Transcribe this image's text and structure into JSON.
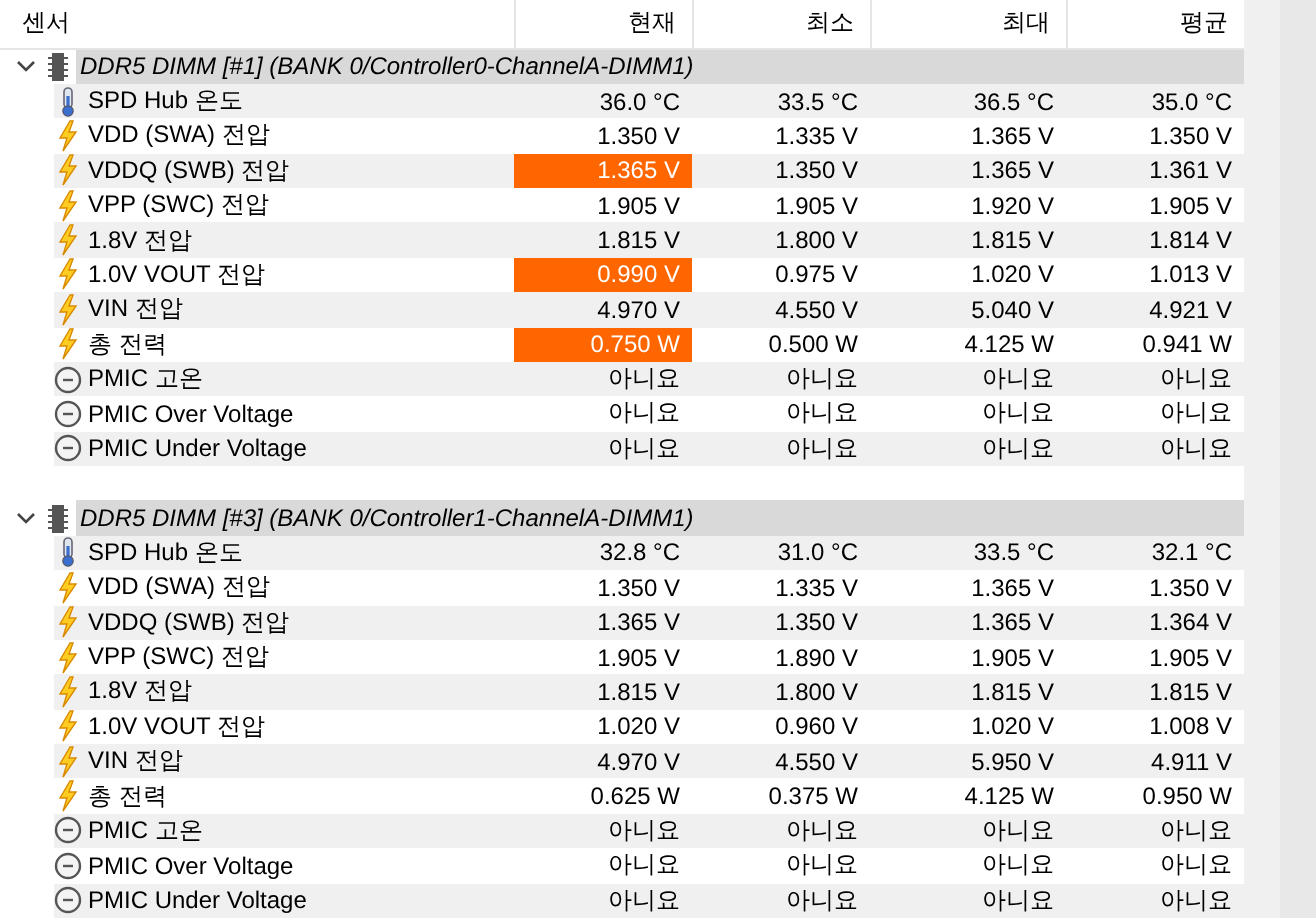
{
  "columns": [
    "센서",
    "현재",
    "최소",
    "최대",
    "평균"
  ],
  "groups": [
    {
      "title": "DDR5 DIMM [#1] (BANK 0/Controller0-ChannelA-DIMM1)",
      "expanded": true,
      "rows": [
        {
          "kind": "temp",
          "label": "SPD Hub 온도",
          "alert": false,
          "values": [
            "36.0 °C",
            "33.5 °C",
            "36.5 °C",
            "35.0 °C"
          ]
        },
        {
          "kind": "volt",
          "label": "VDD (SWA) 전압",
          "alert": false,
          "values": [
            "1.350 V",
            "1.335 V",
            "1.365 V",
            "1.350 V"
          ]
        },
        {
          "kind": "volt",
          "label": "VDDQ (SWB) 전압",
          "alert": true,
          "values": [
            "1.365 V",
            "1.350 V",
            "1.365 V",
            "1.361 V"
          ]
        },
        {
          "kind": "volt",
          "label": "VPP (SWC) 전압",
          "alert": false,
          "values": [
            "1.905 V",
            "1.905 V",
            "1.920 V",
            "1.905 V"
          ]
        },
        {
          "kind": "volt",
          "label": "1.8V 전압",
          "alert": false,
          "values": [
            "1.815 V",
            "1.800 V",
            "1.815 V",
            "1.814 V"
          ]
        },
        {
          "kind": "volt",
          "label": "1.0V VOUT 전압",
          "alert": true,
          "values": [
            "0.990 V",
            "0.975 V",
            "1.020 V",
            "1.013 V"
          ]
        },
        {
          "kind": "volt",
          "label": "VIN 전압",
          "alert": false,
          "values": [
            "4.970 V",
            "4.550 V",
            "5.040 V",
            "4.921 V"
          ]
        },
        {
          "kind": "volt",
          "label": "총 전력",
          "alert": true,
          "values": [
            "0.750 W",
            "0.500 W",
            "4.125 W",
            "0.941 W"
          ]
        },
        {
          "kind": "flag",
          "label": "PMIC 고온",
          "alert": false,
          "values": [
            "아니요",
            "아니요",
            "아니요",
            "아니요"
          ]
        },
        {
          "kind": "flag",
          "label": "PMIC Over Voltage",
          "alert": false,
          "values": [
            "아니요",
            "아니요",
            "아니요",
            "아니요"
          ]
        },
        {
          "kind": "flag",
          "label": "PMIC Under Voltage",
          "alert": false,
          "values": [
            "아니요",
            "아니요",
            "아니요",
            "아니요"
          ]
        }
      ]
    },
    {
      "title": "DDR5 DIMM [#3] (BANK 0/Controller1-ChannelA-DIMM1)",
      "expanded": true,
      "rows": [
        {
          "kind": "temp",
          "label": "SPD Hub 온도",
          "alert": false,
          "values": [
            "32.8 °C",
            "31.0 °C",
            "33.5 °C",
            "32.1 °C"
          ]
        },
        {
          "kind": "volt",
          "label": "VDD (SWA) 전압",
          "alert": false,
          "values": [
            "1.350 V",
            "1.335 V",
            "1.365 V",
            "1.350 V"
          ]
        },
        {
          "kind": "volt",
          "label": "VDDQ (SWB) 전압",
          "alert": false,
          "values": [
            "1.365 V",
            "1.350 V",
            "1.365 V",
            "1.364 V"
          ]
        },
        {
          "kind": "volt",
          "label": "VPP (SWC) 전압",
          "alert": false,
          "values": [
            "1.905 V",
            "1.890 V",
            "1.905 V",
            "1.905 V"
          ]
        },
        {
          "kind": "volt",
          "label": "1.8V 전압",
          "alert": false,
          "values": [
            "1.815 V",
            "1.800 V",
            "1.815 V",
            "1.815 V"
          ]
        },
        {
          "kind": "volt",
          "label": "1.0V VOUT 전압",
          "alert": false,
          "values": [
            "1.020 V",
            "0.960 V",
            "1.020 V",
            "1.008 V"
          ]
        },
        {
          "kind": "volt",
          "label": "VIN 전압",
          "alert": false,
          "values": [
            "4.970 V",
            "4.550 V",
            "5.950 V",
            "4.911 V"
          ]
        },
        {
          "kind": "volt",
          "label": "총 전력",
          "alert": false,
          "values": [
            "0.625 W",
            "0.375 W",
            "4.125 W",
            "0.950 W"
          ]
        },
        {
          "kind": "flag",
          "label": "PMIC 고온",
          "alert": false,
          "values": [
            "아니요",
            "아니요",
            "아니요",
            "아니요"
          ]
        },
        {
          "kind": "flag",
          "label": "PMIC Over Voltage",
          "alert": false,
          "values": [
            "아니요",
            "아니요",
            "아니요",
            "아니요"
          ]
        },
        {
          "kind": "flag",
          "label": "PMIC Under Voltage",
          "alert": false,
          "values": [
            "아니요",
            "아니요",
            "아니요",
            "아니요"
          ]
        }
      ]
    }
  ]
}
